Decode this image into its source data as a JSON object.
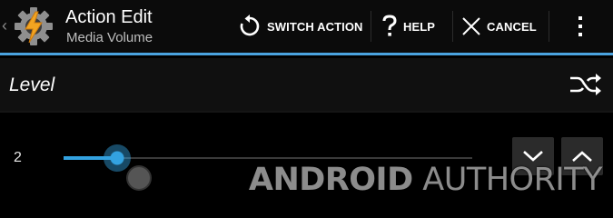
{
  "header": {
    "title": "Action Edit",
    "subtitle": "Media Volume",
    "up_icon": "chevron-left-icon",
    "app_icon": "tasker-gear-bolt-icon"
  },
  "toolbar": {
    "switch_action_label": "SWITCH ACTION",
    "help_label": "HELP",
    "cancel_label": "CANCEL",
    "icons": {
      "switch_action": "rotate-arrow-icon",
      "help": "question-mark-icon",
      "cancel": "close-icon",
      "overflow": "overflow-menu-icon"
    }
  },
  "level": {
    "label": "Level",
    "shuffle_icon": "shuffle-icon",
    "value_text": "2",
    "slider_fraction": 0.13
  },
  "steppers": {
    "down_icon": "chevron-down-icon",
    "up_icon": "chevron-up-icon"
  },
  "watermark": {
    "part1": "ANDROID",
    "part2": "AUTHORITY"
  },
  "colors": {
    "accent": "#33a2e0",
    "action_bar_line": "#4aa3df",
    "background": "#000000"
  }
}
